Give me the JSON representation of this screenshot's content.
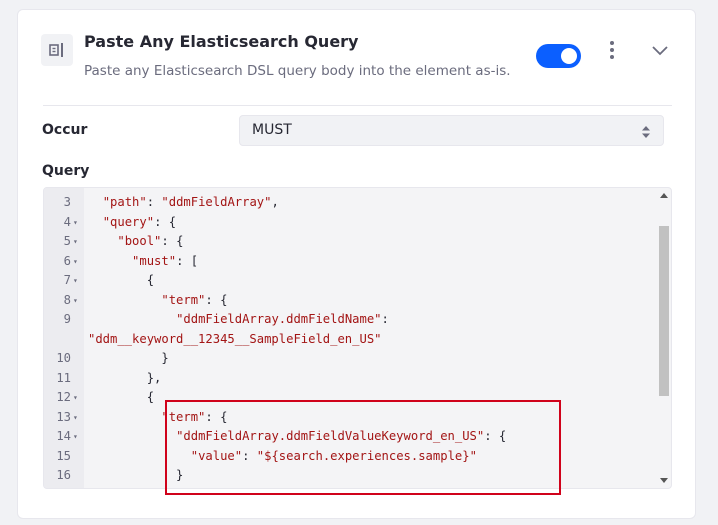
{
  "element": {
    "title": "Paste Any Elasticsearch Query",
    "subtitle": "Paste any Elasticsearch DSL query body into the element as-is.",
    "icon": "paste-element-icon",
    "enabled": true,
    "menu_icon": "kebab-menu-icon",
    "collapse_icon": "chevron-down-icon"
  },
  "occur": {
    "label": "Occur",
    "value": "MUST"
  },
  "query": {
    "label": "Query",
    "lines": [
      {
        "num": "3",
        "fold": false,
        "indent": "  ",
        "text": "\"path\": \"ddmFieldArray\","
      },
      {
        "num": "4",
        "fold": true,
        "indent": "  ",
        "text": "\"query\": {"
      },
      {
        "num": "5",
        "fold": true,
        "indent": "    ",
        "text": "\"bool\": {"
      },
      {
        "num": "6",
        "fold": true,
        "indent": "      ",
        "text": "\"must\": ["
      },
      {
        "num": "7",
        "fold": true,
        "indent": "        ",
        "text": "{"
      },
      {
        "num": "8",
        "fold": true,
        "indent": "          ",
        "text": "\"term\": {"
      },
      {
        "num": "9",
        "fold": false,
        "indent": "            ",
        "text": "\"ddmFieldArray.ddmFieldName\":"
      },
      {
        "num": "",
        "fold": false,
        "indent": "",
        "text": "\"ddm__keyword__12345__SampleField_en_US\""
      },
      {
        "num": "10",
        "fold": false,
        "indent": "          ",
        "text": "}"
      },
      {
        "num": "11",
        "fold": false,
        "indent": "        ",
        "text": "},"
      },
      {
        "num": "12",
        "fold": true,
        "indent": "        ",
        "text": "{"
      },
      {
        "num": "13",
        "fold": true,
        "indent": "          ",
        "text": "\"term\": {"
      },
      {
        "num": "14",
        "fold": true,
        "indent": "            ",
        "text": "\"ddmFieldArray.ddmFieldValueKeyword_en_US\": {"
      },
      {
        "num": "15",
        "fold": false,
        "indent": "              ",
        "text": "\"value\": \"${search.experiences.sample}\""
      },
      {
        "num": "16",
        "fold": false,
        "indent": "            ",
        "text": "}"
      }
    ]
  },
  "colors": {
    "accent": "#0b5fff",
    "string": "#a31515",
    "highlight": "#d0021b"
  }
}
